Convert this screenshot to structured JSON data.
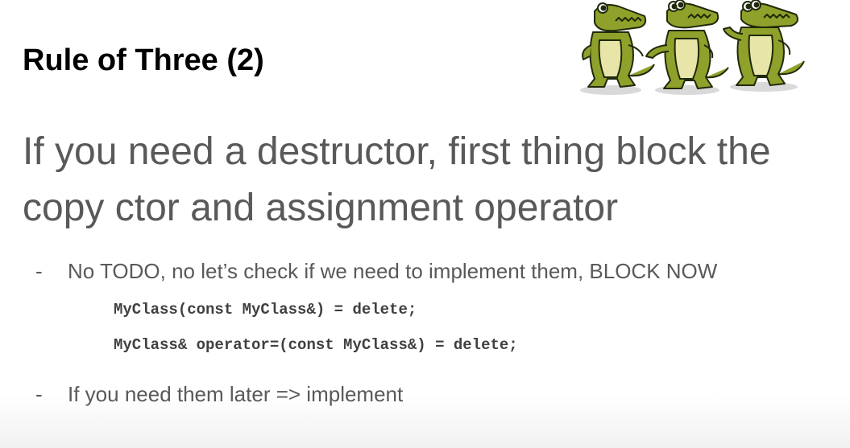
{
  "slide": {
    "title": "Rule of Three (2)",
    "headline": "If you need a destructor, first thing block the copy ctor and assignment operator",
    "bullets": [
      {
        "dash": "-",
        "text": "No TODO, no let’s check if we need to implement them, BLOCK NOW"
      },
      {
        "dash": "-",
        "text": "If you need them later => implement"
      }
    ],
    "code_lines": [
      "MyClass(const MyClass&) = delete;",
      "MyClass& operator=(const MyClass&) = delete;"
    ]
  },
  "illustration": {
    "icon": "crocodile-mascots-icon",
    "count": 3,
    "body_color": "#8fa12a",
    "belly_color": "#e8e5a8",
    "outline_color": "#1f2a0a"
  }
}
